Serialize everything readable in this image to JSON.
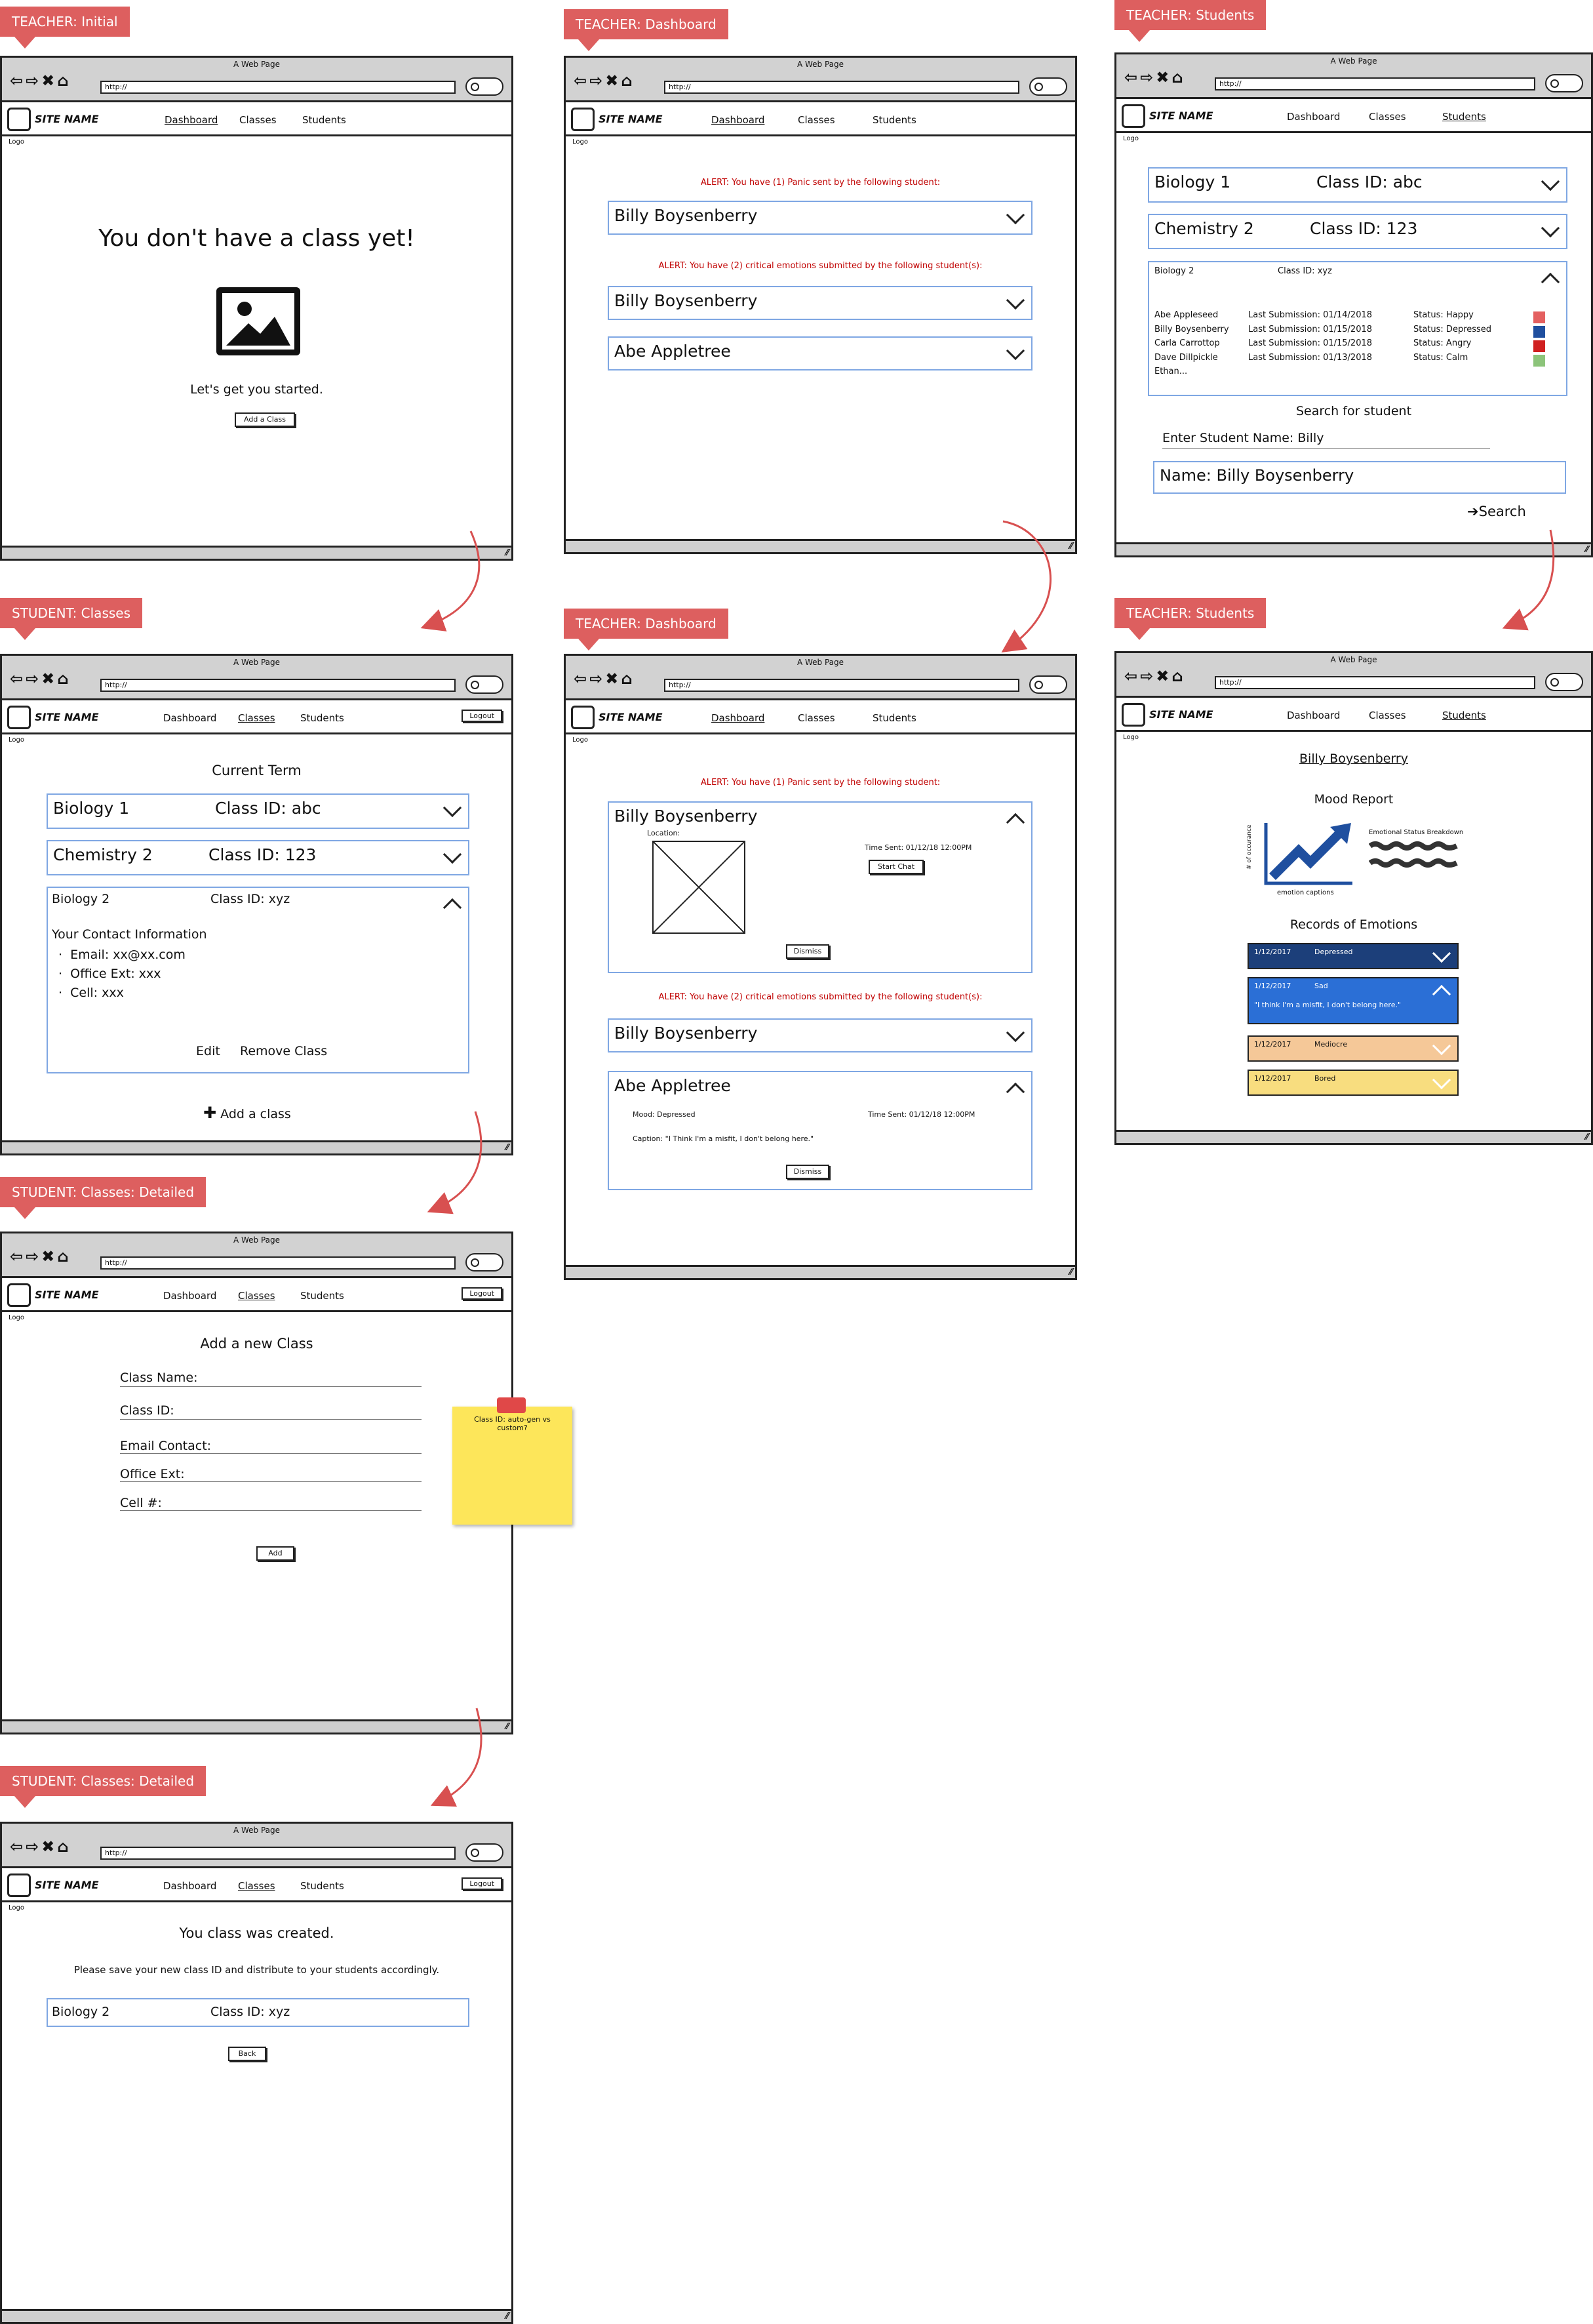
{
  "window_title": "A Web Page",
  "url": "http://",
  "site_name": "SITE NAME",
  "logo": "Logo",
  "nav": {
    "dashboard": "Dashboard",
    "classes": "Classes",
    "students": "Students",
    "logout": "Logout"
  },
  "tags": {
    "t_initial": "TEACHER: Initial",
    "t_dash": "TEACHER: Dashboard",
    "t_students": "TEACHER: Students",
    "s_classes": "STUDENT: Classes",
    "s_detailed": "STUDENT: Classes: Detailed"
  },
  "initial": {
    "headline": "You don't have a class yet!",
    "sub": "Let's get you started.",
    "button": "Add a Class"
  },
  "dash": {
    "panic_alert": "ALERT: You have (1) Panic sent by the following student:",
    "critical_alert": "ALERT: You have (2) critical emotions submitted by the following student(s):",
    "student1": "Billy Boysenberry",
    "student2": "Abe Appletree",
    "location": "Location:",
    "time_sent": "Time Sent: 01/12/18 12:00PM",
    "start_chat": "Start Chat",
    "dismiss": "Dismiss",
    "mood": "Mood: Depressed",
    "caption": "Caption: \"I Think I'm a misfit, I don't belong here.\""
  },
  "classes": [
    {
      "name": "Biology 1",
      "id": "Class ID: abc"
    },
    {
      "name": "Chemistry 2",
      "id": "Class ID: 123"
    },
    {
      "name": "Biology 2",
      "id": "Class ID: xyz"
    }
  ],
  "students_page": {
    "roster": [
      {
        "name": "Abe Appleseed",
        "last": "Last Submission: 01/14/2018",
        "status": "Status: Happy",
        "color": "#e46060"
      },
      {
        "name": "Billy Boysenberry",
        "last": "Last Submission: 01/15/2018",
        "status": "Status: Depressed",
        "color": "#1f4f9f"
      },
      {
        "name": "Carla Carrottop",
        "last": "Last Submission: 01/15/2018",
        "status": "Status: Angry",
        "color": "#d02020"
      },
      {
        "name": "Dave Dillpickle",
        "last": "Last Submission: 01/13/2018",
        "status": "Status: Calm",
        "color": "#8cc47a"
      },
      {
        "name": "Ethan...",
        "last": "",
        "status": "",
        "color": ""
      }
    ],
    "search_title": "Search for student",
    "search_label": "Enter Student Name: Billy",
    "result": "Name: Billy Boysenberry",
    "search_btn": "Search"
  },
  "student_detail": {
    "name": "Billy Boysenberry",
    "mood_report": "Mood Report",
    "y_axis": "# of occurance",
    "x_axis": "emotion captions",
    "breakdown": "Emotional Status Breakdown",
    "records_title": "Records of Emotions",
    "records": [
      {
        "date": "1/12/2017",
        "mood": "Depressed",
        "color": "#1c3f7a",
        "text": "#ffffff"
      },
      {
        "date": "1/12/2017",
        "mood": "Sad",
        "color": "#2b6fd6",
        "text": "#ffffff",
        "caption": "\"I think I'm a misfit, I don't belong here.\""
      },
      {
        "date": "1/12/2017",
        "mood": "Mediocre",
        "color": "#f5c898",
        "text": "#222222"
      },
      {
        "date": "1/12/2017",
        "mood": "Bored",
        "color": "#f8dd7f",
        "text": "#222222"
      }
    ]
  },
  "student_classes": {
    "term": "Current Term",
    "contact_title": "Your Contact Information",
    "contact": [
      "Email: xx@xx.com",
      "Office Ext: xxx",
      "Cell: xxx"
    ],
    "edit": "Edit",
    "remove": "Remove Class",
    "add": "Add a class"
  },
  "add_form": {
    "title": "Add a new Class",
    "fields": [
      "Class Name:",
      "Class ID:",
      "Email Contact:",
      "Office Ext:",
      "Cell #:"
    ],
    "button": "Add",
    "sticky": "Class ID: auto-gen vs custom?"
  },
  "created": {
    "msg": "You class was created.",
    "note": "Please save your new class ID and distribute to your students accordingly.",
    "back": "Back"
  }
}
